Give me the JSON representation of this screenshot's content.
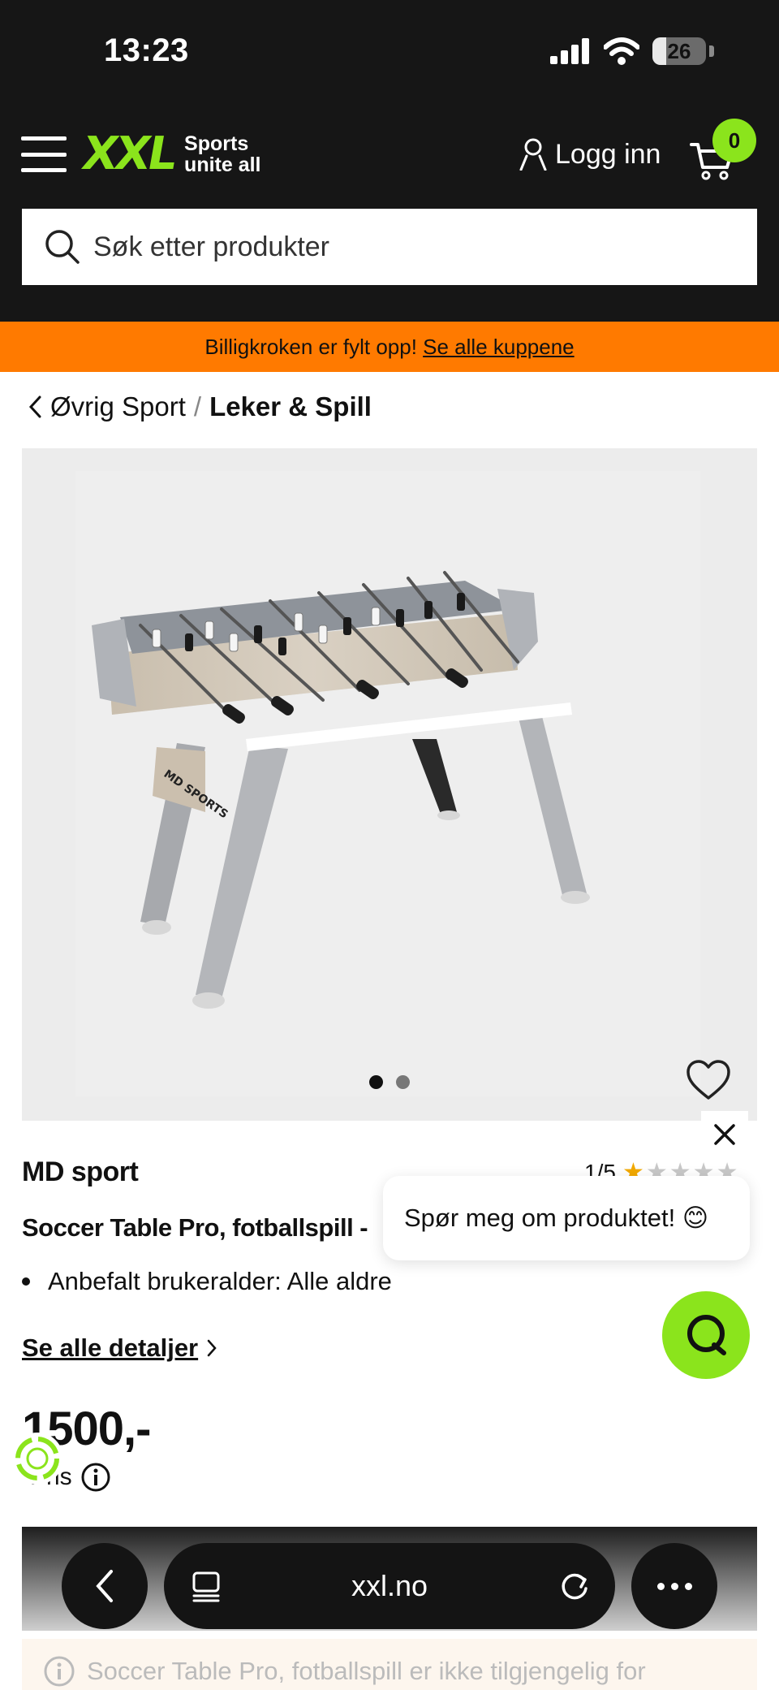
{
  "status_bar": {
    "time": "13:23",
    "battery": "26",
    "battery_level": 0.26
  },
  "header": {
    "logo": {
      "word": "XXL",
      "tagline_line1": "Sports",
      "tagline_line2": "unite all"
    },
    "login_label": "Logg inn",
    "cart_count": "0",
    "search_placeholder": "Søk etter produkter",
    "accent_color": "#8be41c"
  },
  "promo": {
    "text": "Billigkroken er fylt opp! ",
    "link": "Se alle kuppene",
    "color": "#ff7a00"
  },
  "breadcrumb": {
    "parent": "Øvrig Sport",
    "separator": "/",
    "current": "Leker & Spill"
  },
  "gallery": {
    "image_count": 2,
    "active_index": 0
  },
  "product": {
    "brand": "MD sport",
    "rating_text": "1/5",
    "rating_value": 1,
    "rating_max": 5,
    "title": "Soccer Table Pro, fotballspill -",
    "bullets": [
      "Anbefalt brukeralder: Alle aldre"
    ],
    "details_link": "Se alle detaljer",
    "price": "1500,-",
    "price_label": "-Pris"
  },
  "chat": {
    "bubble_text": "Spør meg om produktet! 😊"
  },
  "browser": {
    "url": "xxl.no"
  },
  "notice": {
    "text": "Soccer Table Pro, fotballspill er ikke tilgjengelig for"
  }
}
